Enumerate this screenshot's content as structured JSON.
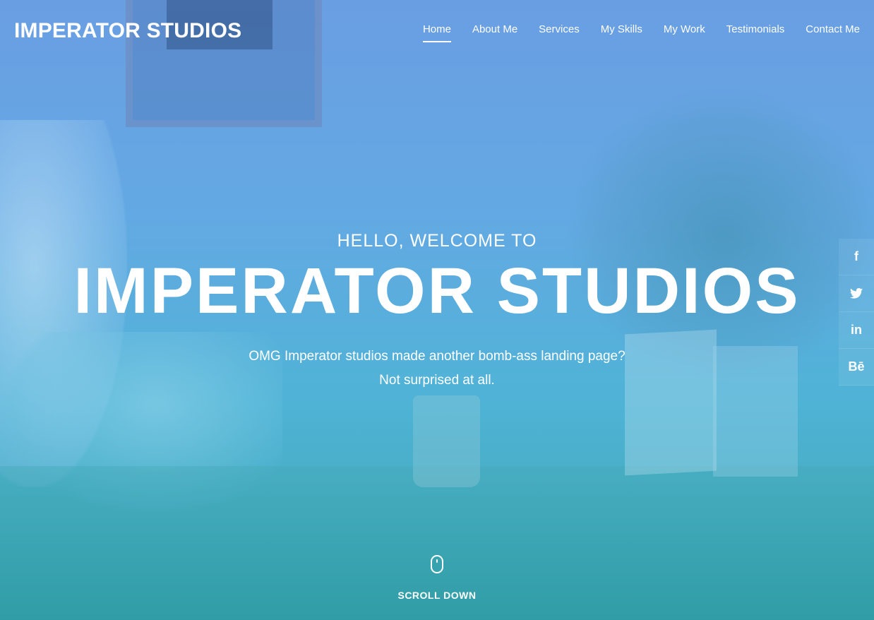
{
  "brand": {
    "name": "IMPERATOR STUDIOS"
  },
  "nav": {
    "items": [
      {
        "label": "Home",
        "active": true
      },
      {
        "label": "About Me"
      },
      {
        "label": "Services"
      },
      {
        "label": "My Skills"
      },
      {
        "label": "My Work"
      },
      {
        "label": "Testimonials"
      },
      {
        "label": "Contact Me"
      }
    ]
  },
  "hero": {
    "kicker": "HELLO, WELCOME TO",
    "title": "IMPERATOR STUDIOS",
    "subtitle_line1": "OMG Imperator studios made another bomb-ass landing page?",
    "subtitle_line2": "Not surprised at all."
  },
  "social": [
    {
      "icon": "facebook-icon",
      "glyph": "f"
    },
    {
      "icon": "twitter-icon",
      "glyph": "🐦"
    },
    {
      "icon": "linkedin-icon",
      "glyph": "in"
    },
    {
      "icon": "behance-icon",
      "glyph": "Bē"
    }
  ],
  "scroll": {
    "label": "SCROLL DOWN"
  },
  "colors": {
    "gradient_top": "#6a9ee3",
    "gradient_bottom": "#3aa6ad",
    "text": "#ffffff"
  }
}
